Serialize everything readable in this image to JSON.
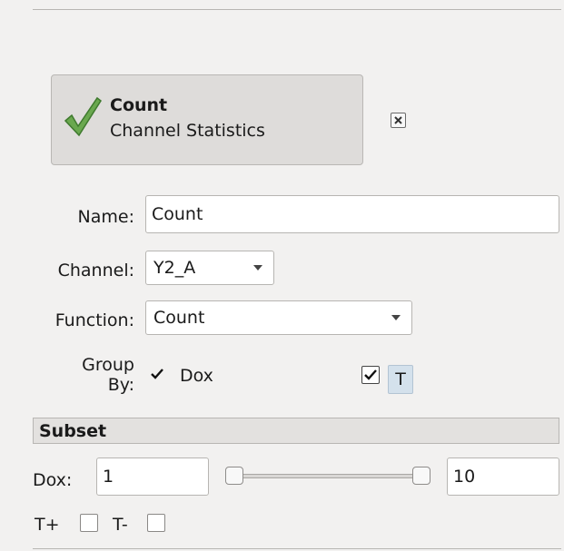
{
  "operation": {
    "title": "Count",
    "subtitle": "Channel Statistics",
    "status_icon": "checkmark-icon",
    "status_color": "#5e9e3a"
  },
  "form": {
    "name_label": "Name:",
    "name_value": "Count",
    "channel_label": "Channel:",
    "channel_value": "Y2_A",
    "function_label": "Function:",
    "function_value": "Count",
    "group_by_label_line1": "Group",
    "group_by_label_line2": "By:",
    "group_by_options": [
      {
        "label": "Dox",
        "checked": true
      },
      {
        "label": "T",
        "checked": true
      }
    ]
  },
  "subset": {
    "header": "Subset",
    "dox_label": "Dox:",
    "dox_min": "1",
    "dox_max": "10",
    "t_plus_label": "T+",
    "t_minus_label": "T-",
    "t_plus_checked": false,
    "t_minus_checked": false
  }
}
